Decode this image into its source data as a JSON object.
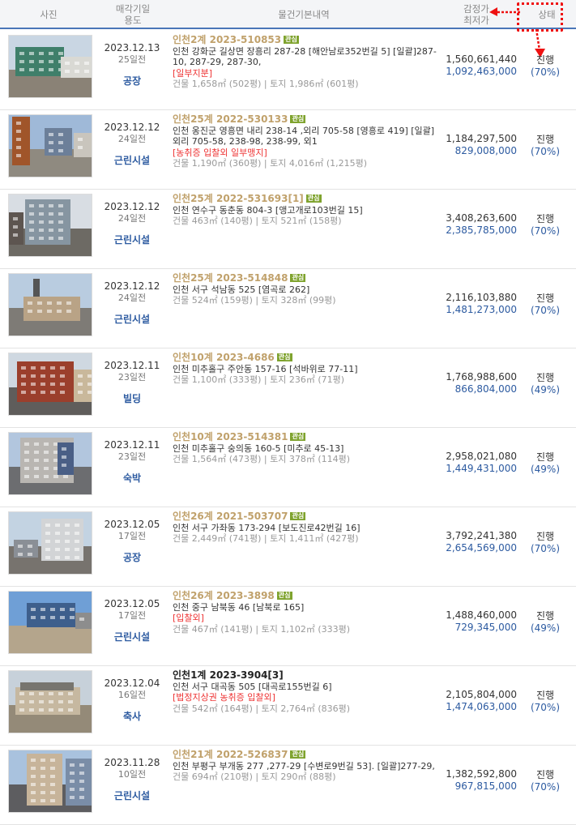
{
  "header": {
    "photo": "사진",
    "date_line1": "매각기일",
    "date_line2": "용도",
    "info": "물건기본내역",
    "price_line1": "감정가",
    "price_line2": "최저가",
    "status": "상태"
  },
  "colors": {
    "accent": "#2c5aa0",
    "case_gold": "#c0a16b",
    "warning": "#e33333",
    "highlight": "#e11111"
  },
  "rows": [
    {
      "date": "2023.12.13",
      "days": "25일전",
      "usage": "공장",
      "case": "인천2계 2023-510853",
      "case_dark": false,
      "badge": "관심",
      "address": "인천 강화군 길상면 장흥리 287-28 [해안남로352번길 5] [일괄]287-10, 287-29, 287-30,",
      "warning": "[일부지분]",
      "area": "건물 1,658㎡ (502평)  |  토지 1,986㎡ (601평)",
      "appraise": "1,560,661,440",
      "minimum": "1,092,463,000",
      "status": "진행",
      "rate": "(70%)"
    },
    {
      "date": "2023.12.12",
      "days": "24일전",
      "usage": "근린시설",
      "case": "인천25계 2022-530133",
      "case_dark": false,
      "badge": "관심",
      "address": "인천 옹진군 영흥면 내리 238-14 ,외리 705-58 [영흥로 419] [일괄]외리 705-58, 238-98, 238-99, 외1",
      "warning": "[농취증   입찰외   일부맹지]",
      "area": "건물 1,190㎡ (360평)  |  토지 4,016㎡ (1,215평)",
      "appraise": "1,184,297,500",
      "minimum": "829,008,000",
      "status": "진행",
      "rate": "(70%)"
    },
    {
      "date": "2023.12.12",
      "days": "24일전",
      "usage": "근린시설",
      "case": "인천25계 2022-531693[1]",
      "case_dark": false,
      "badge": "관심",
      "address": "인천 연수구 동춘동 804-3 [앵고개로103번길 15]",
      "warning": "",
      "area": "건물 463㎡ (140평)  |  토지 521㎡ (158평)",
      "appraise": "3,408,263,600",
      "minimum": "2,385,785,000",
      "status": "진행",
      "rate": "(70%)"
    },
    {
      "date": "2023.12.12",
      "days": "24일전",
      "usage": "근린시설",
      "case": "인천25계 2023-514848",
      "case_dark": false,
      "badge": "관심",
      "address": "인천 서구 석남동 525 [염곡로 262]",
      "warning": "",
      "area": "건물 524㎡ (159평)  |  토지 328㎡ (99평)",
      "appraise": "2,116,103,880",
      "minimum": "1,481,273,000",
      "status": "진행",
      "rate": "(70%)"
    },
    {
      "date": "2023.12.11",
      "days": "23일전",
      "usage": "빌딩",
      "case": "인천10계 2023-4686",
      "case_dark": false,
      "badge": "관심",
      "address": "인천 미추홀구 주안동 157-16 [석바위로 77-11]",
      "warning": "",
      "area": "건물 1,100㎡ (333평)  |  토지 236㎡ (71평)",
      "appraise": "1,768,988,600",
      "minimum": "866,804,000",
      "status": "진행",
      "rate": "(49%)"
    },
    {
      "date": "2023.12.11",
      "days": "23일전",
      "usage": "숙박",
      "case": "인천10계 2023-514381",
      "case_dark": false,
      "badge": "관심",
      "address": "인천 미추홀구 숭의동 160-5 [미추로 45-13]",
      "warning": "",
      "area": "건물 1,564㎡ (473평)  |  토지 378㎡ (114평)",
      "appraise": "2,958,021,080",
      "minimum": "1,449,431,000",
      "status": "진행",
      "rate": "(49%)"
    },
    {
      "date": "2023.12.05",
      "days": "17일전",
      "usage": "공장",
      "case": "인천26계 2021-503707",
      "case_dark": false,
      "badge": "관심",
      "address": "인천 서구 가좌동 173-294 [보도진로42번길 16]",
      "warning": "",
      "area": "건물 2,449㎡ (741평)  |  토지 1,411㎡ (427평)",
      "appraise": "3,792,241,380",
      "minimum": "2,654,569,000",
      "status": "진행",
      "rate": "(70%)"
    },
    {
      "date": "2023.12.05",
      "days": "17일전",
      "usage": "근린시설",
      "case": "인천26계 2023-3898",
      "case_dark": false,
      "badge": "관심",
      "address": "인천 중구 남북동 46 [남북로 165]",
      "warning": "[입찰외]",
      "area": "건물 467㎡ (141평)  |  토지 1,102㎡ (333평)",
      "appraise": "1,488,460,000",
      "minimum": "729,345,000",
      "status": "진행",
      "rate": "(49%)"
    },
    {
      "date": "2023.12.04",
      "days": "16일전",
      "usage": "축사",
      "case": "인천1계 2023-3904[3]",
      "case_dark": true,
      "badge": "",
      "address": "인천 서구 대곡동 505 [대곡로155번길 6]",
      "warning": "[법정지상권   농취증   입찰외]",
      "area": "건물 542㎡ (164평)  |  토지 2,764㎡ (836평)",
      "appraise": "2,105,804,000",
      "minimum": "1,474,063,000",
      "status": "진행",
      "rate": "(70%)"
    },
    {
      "date": "2023.11.28",
      "days": "10일전",
      "usage": "근린시설",
      "case": "인천21계 2022-526837",
      "case_dark": false,
      "badge": "관심",
      "address": "인천 부평구 부개동 277 ,277-29 [수변로9번길 53]. [일괄]277-29,",
      "warning": "",
      "area": "건물 694㎡ (210평)  |  토지 290㎡ (88평)",
      "appraise": "1,382,592,800",
      "minimum": "967,815,000",
      "status": "진행",
      "rate": "(70%)"
    }
  ]
}
